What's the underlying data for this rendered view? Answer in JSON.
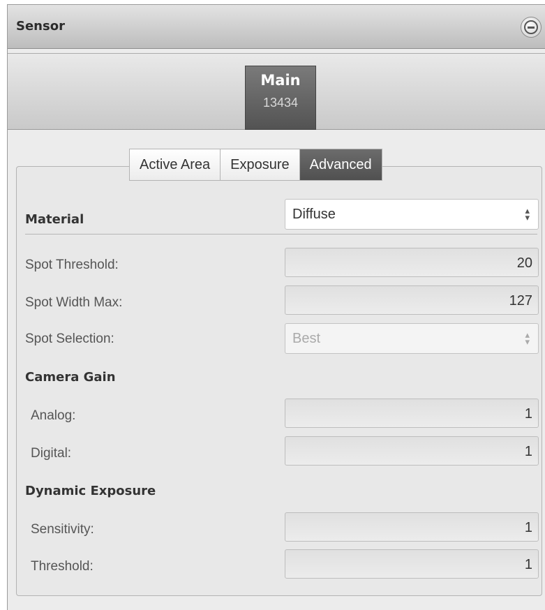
{
  "panel": {
    "title": "Sensor",
    "collapse_icon": "minus-circle-icon"
  },
  "sensor": {
    "name": "Main",
    "serial": "13434"
  },
  "tabs": [
    {
      "label": "Active Area",
      "active": false
    },
    {
      "label": "Exposure",
      "active": false
    },
    {
      "label": "Advanced",
      "active": true
    }
  ],
  "advanced": {
    "material": {
      "label": "Material",
      "value": "Diffuse"
    },
    "spot_threshold": {
      "label": "Spot Threshold:",
      "value": "20"
    },
    "spot_width_max": {
      "label": "Spot Width Max:",
      "value": "127"
    },
    "spot_selection": {
      "label": "Spot Selection:",
      "value": "Best",
      "disabled": true
    },
    "camera_gain": {
      "heading": "Camera Gain",
      "analog": {
        "label": "Analog:",
        "value": "1"
      },
      "digital": {
        "label": "Digital:",
        "value": "1"
      }
    },
    "dynamic_exposure": {
      "heading": "Dynamic Exposure",
      "sensitivity": {
        "label": "Sensitivity:",
        "value": "1"
      },
      "threshold": {
        "label": "Threshold:",
        "value": "1"
      }
    }
  },
  "colors": {
    "active_tab": "#5c5c5c",
    "header_top": "#e3e3e3",
    "header_bottom": "#bdbdbd"
  }
}
